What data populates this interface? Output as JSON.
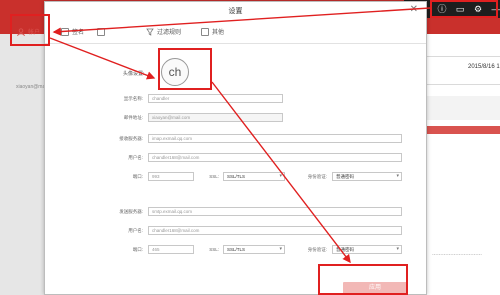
{
  "background": {
    "sidebar_account": "xiaoyan@mail.com",
    "mail_date": "2015/8/16 1",
    "paragraph": "…………………………"
  },
  "window_controls": {
    "info_icon": "info-icon",
    "monitor_icon": "monitor-icon",
    "gear_icon": "gear-icon",
    "minimize_icon": "minimize-icon"
  },
  "dialog": {
    "title": "设置",
    "close_label": "✕",
    "tabs": [
      {
        "label": "帐户",
        "icon": "user-icon",
        "active": true
      },
      {
        "label": "签名",
        "icon": "pen-icon",
        "active": false
      },
      {
        "label": "",
        "icon": "mail-icon",
        "active": false
      },
      {
        "label": "过滤规则",
        "icon": "filter-icon",
        "active": false
      },
      {
        "label": "其他",
        "icon": "list-icon",
        "active": false
      }
    ],
    "avatar": {
      "label": "头像设置:",
      "initials": "ch"
    },
    "basic": {
      "display_name": {
        "label": "显示名称:",
        "value": "chandler"
      },
      "email": {
        "label": "邮件地址:",
        "value": "xiaoyan@mail.com"
      }
    },
    "incoming": {
      "server": {
        "label": "接收服务器:",
        "value": "imap.exmail.qq.com"
      },
      "username": {
        "label": "用户名:",
        "value": "chandler168@mail.com"
      },
      "port_label": "端口:",
      "port_value": "993",
      "ssl_label": "SSL:",
      "ssl_value": "SSL/TLS",
      "auth_label": "身份验证:",
      "auth_value": "普通密码"
    },
    "outgoing": {
      "server": {
        "label": "发送服务器:",
        "value": "smtp.exmail.qq.com"
      },
      "username": {
        "label": "用户名:",
        "value": "chandler168@mail.com"
      },
      "port_label": "端口:",
      "port_value": "465",
      "ssl_label": "SSL:",
      "ssl_value": "SSL/TLS",
      "auth_label": "身份验证:",
      "auth_value": "普通密码"
    },
    "apply_label": "应用"
  },
  "annotation_color": "#e02020",
  "accent_color": "#c9302c"
}
